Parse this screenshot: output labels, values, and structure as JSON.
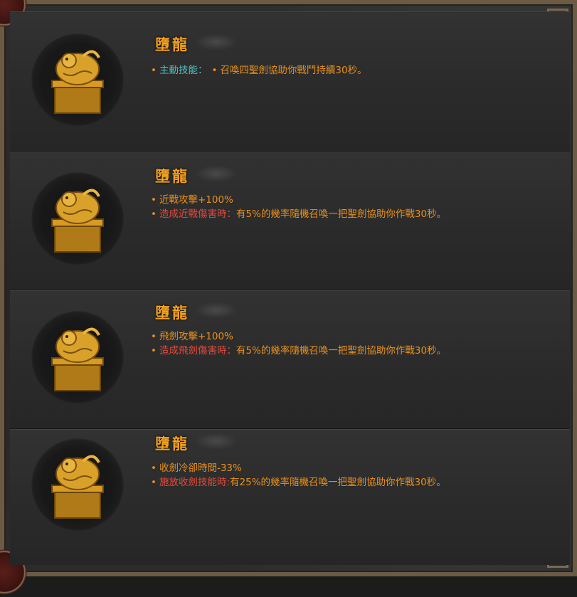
{
  "colors": {
    "name": "#f3a21f",
    "effect": "#e8901e",
    "active_label": "#4fc2c2",
    "trigger_label": "#e24a3c"
  },
  "icon": "golden-dragon-seal-icon",
  "items": [
    {
      "name": "墮龍",
      "lines": [
        {
          "label": "主動技能：",
          "sep": "•",
          "text": "召喚四聖劍協助你戰鬥持續30秒。"
        }
      ]
    },
    {
      "name": "墮龍",
      "lines": [
        {
          "text": "近戰攻擊+100%"
        },
        {
          "label": "造成近戰傷害時：",
          "text": "有5%的幾率隨機召喚一把聖劍協助你作戰30秒。"
        }
      ]
    },
    {
      "name": "墮龍",
      "lines": [
        {
          "text": "飛劍攻擊+100%"
        },
        {
          "label": "造成飛劍傷害時：",
          "text": "有5%的幾率隨機召喚一把聖劍協助你作戰30秒。"
        }
      ]
    },
    {
      "name": "墮龍",
      "lines": [
        {
          "text": "收劍冷卻時間-33%"
        },
        {
          "label": "施放收劍技能時:",
          "text": "有25%的幾率隨機召喚一把聖劍協助你作戰30秒。"
        }
      ]
    }
  ]
}
